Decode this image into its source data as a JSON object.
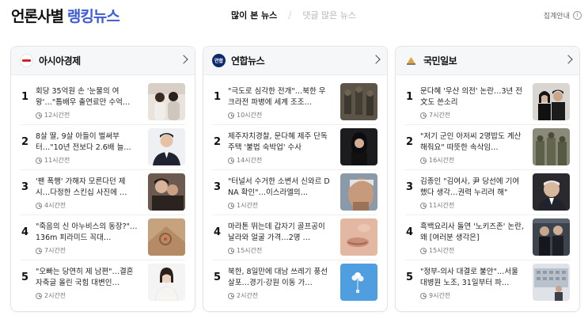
{
  "header": {
    "title_plain": "언론사별",
    "title_accent": "랭킹뉴스",
    "tabs": [
      {
        "label": "많이 본 뉴스",
        "active": true
      },
      {
        "label": "댓글 많은 뉴스",
        "active": false
      }
    ],
    "info_label": "집계안내",
    "info_icon": "info-icon"
  },
  "presses": [
    {
      "name": "아시아경제",
      "logo_text": "아시아경제",
      "logo_icon": "asiae-logo",
      "items": [
        {
          "rank": "1",
          "headline": "회당 35억원 손 '눈물의 여왕'…\"톱배우 출연료만 수억…",
          "time": "12시간전",
          "thumb": "couple-photo"
        },
        {
          "rank": "2",
          "headline": "8살 딸, 9살 아들이 벌써부터…\"10년 전보다 2.6배 늘…",
          "time": "11시간전",
          "thumb": "man-in-suit-photo"
        },
        {
          "rank": "3",
          "headline": "'팬 폭행' 가해자 모른다던 제시…다정한 스킨십 사진에 …",
          "time": "4시간전",
          "thumb": "two-people-photo"
        },
        {
          "rank": "4",
          "headline": "\"죽음의 신 아누비스의 동장?\"…136m 피라미드 꼭대…",
          "time": "7시간전",
          "thumb": "pyramid-photo"
        },
        {
          "rank": "5",
          "headline": "\"오빠는 당연히 제 남편\"…결혼 자축글 올린 국힘 대변인…",
          "time": "2시간전",
          "thumb": "woman-portrait-photo"
        }
      ]
    },
    {
      "name": "연합뉴스",
      "logo_text": "연합",
      "logo_icon": "yonhap-logo",
      "items": [
        {
          "rank": "1",
          "headline": "\"극도로 심각한 전개\"…북한 우크라전 파병에 세계 조조…",
          "time": "10시간전",
          "thumb": "soldiers-photo"
        },
        {
          "rank": "2",
          "headline": "제주자치경찰, 문다혜 제주 단독주택 '불법 숙박업' 수사",
          "time": "14시간전",
          "thumb": "woman-dark-photo"
        },
        {
          "rank": "3",
          "headline": "\"터널서 수거한 소변서 신와르 DNA 확인\"…이스라엘의…",
          "time": "1시간전",
          "thumb": "man-face-photo"
        },
        {
          "rank": "4",
          "headline": "마라톤 뛰는데 갑자기 골프공이 날라와 얼굴 가격…2명 …",
          "time": "15시간전",
          "thumb": "face-closeup-photo"
        },
        {
          "rank": "5",
          "headline": "북한, 8일만에 대남 쓰레기 풍선 살포…경기·강원 이동 가…",
          "time": "2시간전",
          "thumb": "balloon-sky-photo"
        }
      ]
    },
    {
      "name": "국민일보",
      "logo_text": "",
      "logo_icon": "kmib-logo",
      "items": [
        {
          "rank": "1",
          "headline": "문다혜 '우산 의전' 논란…3년 전 文도 쓴소리",
          "time": "7시간전",
          "thumb": "umbrella-couple-photo"
        },
        {
          "rank": "2",
          "headline": "\"저기 군인 아저씨 2명밥도 계산해줘요\" 따뜻한 속삭임…",
          "time": "16시간전",
          "thumb": "soldiers-group-photo"
        },
        {
          "rank": "3",
          "headline": "김종인 \"김여사, 尹 당선에 기여했다 생각…권력 누리려 해\"",
          "time": "11시간전",
          "thumb": "old-man-photo"
        },
        {
          "rank": "4",
          "headline": "흑백요리사 돌연 '노키즈존' 논란, 왜 [여러분 생각은]",
          "time": "15시간전",
          "thumb": "chefs-photo"
        },
        {
          "rank": "5",
          "headline": "\"정부-의사 대결로 불안\"…서울대병원 노조, 31일부터 파…",
          "time": "9시간전",
          "thumb": "hospital-photo"
        }
      ]
    }
  ],
  "colors": {
    "accent": "#3d5bd6"
  }
}
